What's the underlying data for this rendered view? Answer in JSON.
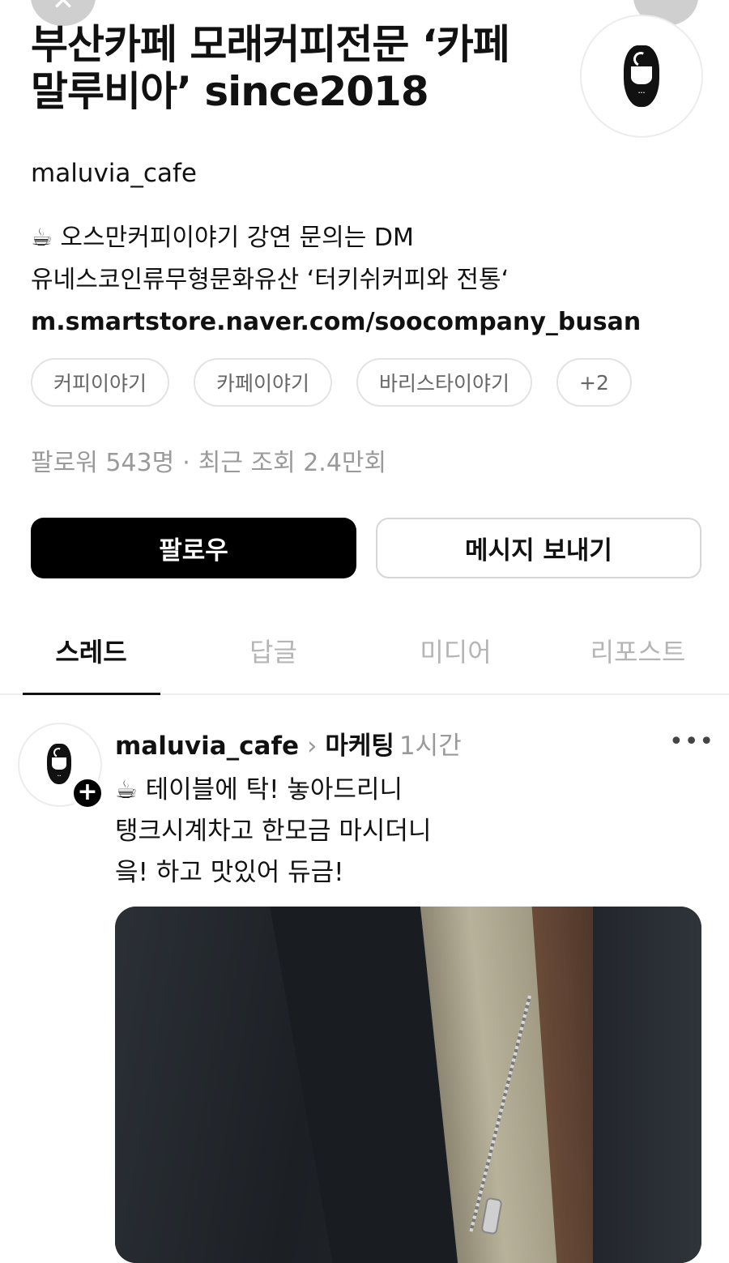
{
  "profile": {
    "title_line1": "부산카페 모래커피전문 ‘카페",
    "title_line2": "말루비아’ since2018",
    "username": "maluvia_cafe",
    "bio_line1": "☕ 오스만커피이야기 강연 문의는 DM",
    "bio_line2": "유네스코인류무형문화유산 ‘터키쉬커피와 전통‘",
    "link": "m.smartstore.naver.com/soocompany_busan",
    "tags": [
      "커피이야기",
      "카페이야기",
      "바리스타이야기",
      "+2"
    ],
    "followers": "팔로워 543명",
    "stats_separator": "·",
    "views": "최근 조회 2.4만회",
    "follow_label": "팔로우",
    "message_label": "메시지 보내기"
  },
  "tabs": [
    "스레드",
    "답글",
    "미디어",
    "리포스트"
  ],
  "active_tab": "스레드",
  "post": {
    "username": "maluvia_cafe",
    "chevron": "›",
    "topic": "마케팅",
    "time": "1시간",
    "more": "•••",
    "plus": "+",
    "text_line1": "☕ 테이블에 탁! 놓아드리니",
    "text_line2": "탱크시계차고 한모금 마시더니",
    "text_line3": "읔! 하고 맛있어 듀금!"
  },
  "icons": {
    "close": "close-icon",
    "avatar_logo": "coffee-cup-moon-logo",
    "more": "more-icon"
  },
  "colors": {
    "follow_button_bg": "#000000",
    "muted_text": "#9a9a9a",
    "tag_border": "#e3e3e3"
  }
}
